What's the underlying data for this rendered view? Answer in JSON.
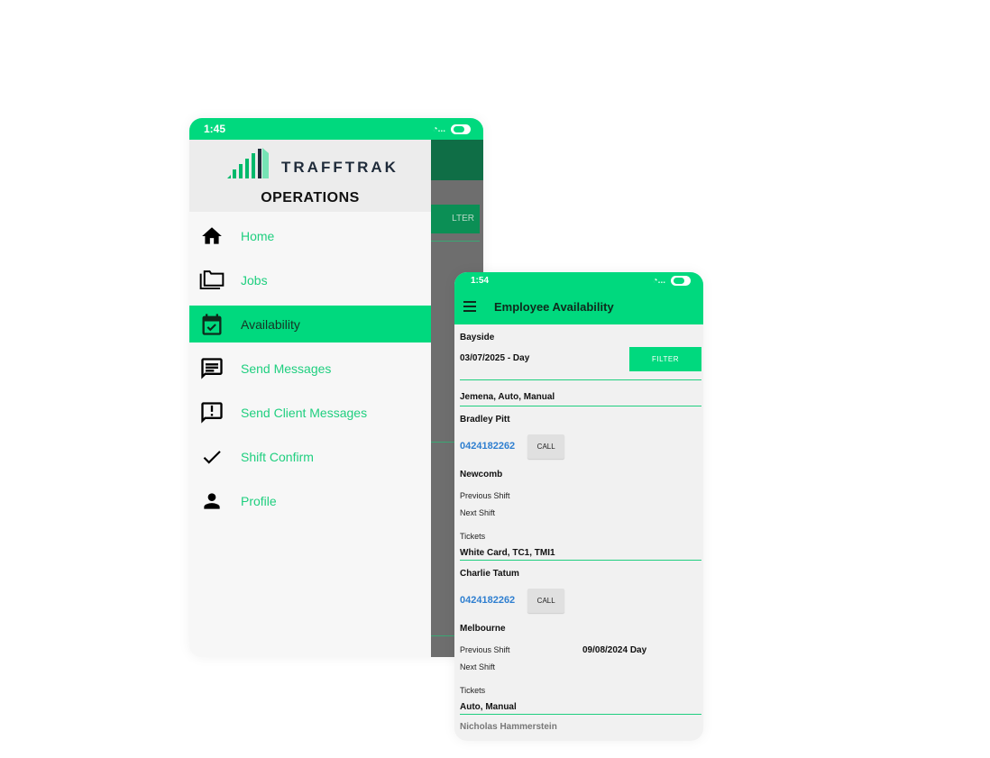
{
  "drawer_phone": {
    "status_time": "1:45",
    "brand": "TRAFFTRAK",
    "section_title": "OPERATIONS",
    "background_filter_label": "LTER",
    "menu": [
      {
        "label": "Home",
        "icon": "home-icon",
        "active": false
      },
      {
        "label": "Jobs",
        "icon": "folders-icon",
        "active": false
      },
      {
        "label": "Availability",
        "icon": "calendar-check-icon",
        "active": true
      },
      {
        "label": "Send Messages",
        "icon": "message-icon",
        "active": false
      },
      {
        "label": "Send Client Messages",
        "icon": "alert-message-icon",
        "active": false
      },
      {
        "label": "Shift Confirm",
        "icon": "check-icon",
        "active": false
      },
      {
        "label": "Profile",
        "icon": "person-icon",
        "active": false
      }
    ]
  },
  "availability_phone": {
    "status_time": "1:54",
    "title": "Employee Availability",
    "location": "Bayside",
    "date": "03/07/2025 - Day",
    "filter_label": "FILTER",
    "client_filter": "Jemena, Auto, Manual",
    "employees": [
      {
        "name": "Bradley Pitt",
        "phone": "0424182262",
        "call_label": "CALL",
        "suburb": "Newcomb",
        "previous_shift_label": "Previous Shift",
        "previous_shift_value": "",
        "next_shift_label": "Next Shift",
        "tickets_label": "Tickets",
        "tickets": "White Card, TC1, TMI1"
      },
      {
        "name": "Charlie Tatum",
        "phone": "0424182262",
        "call_label": "CALL",
        "suburb": "Melbourne",
        "previous_shift_label": "Previous Shift",
        "previous_shift_value": "09/08/2024 Day",
        "next_shift_label": "Next Shift",
        "tickets_label": "Tickets",
        "tickets": "Auto, Manual"
      }
    ],
    "next_name_partial": "Nicholas Hammerstein"
  },
  "colors": {
    "accent": "#00d97e",
    "menu_text": "#1fcf7f",
    "phone_link": "#2f7fd0"
  }
}
